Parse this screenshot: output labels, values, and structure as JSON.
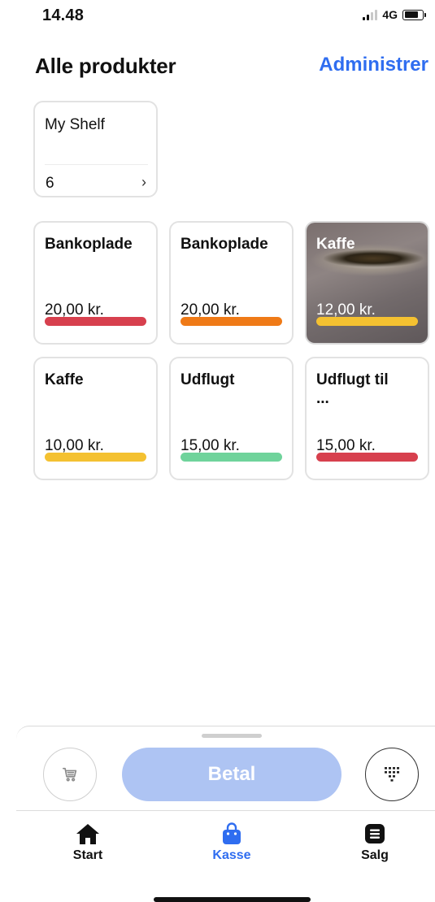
{
  "status_bar": {
    "time": "14.48",
    "network": "4G"
  },
  "header": {
    "title": "Alle produkter",
    "action": "Administrer"
  },
  "shelf": {
    "name": "My Shelf",
    "count": "6",
    "chevron": "›"
  },
  "products": [
    {
      "name": "Bankoplade",
      "price": "20,00 kr.",
      "color": "#d7404e"
    },
    {
      "name": "Bankoplade",
      "price": "20,00 kr.",
      "color": "#ef7a17"
    },
    {
      "name": "Kaffe",
      "price": "12,00 kr.",
      "color": "#f4c131",
      "has_image": true
    },
    {
      "name": "Kaffe",
      "price": "10,00 kr.",
      "color": "#f4c131"
    },
    {
      "name": "Udflugt",
      "price": "15,00 kr.",
      "color": "#6fd39b"
    },
    {
      "name": "Udflugt til ...",
      "price": "15,00 kr.",
      "color": "#d7404e"
    }
  ],
  "checkout": {
    "pay_label": "Betal",
    "cart_icon": "cart-icon",
    "keypad_icon": "keypad-icon"
  },
  "tabs": [
    {
      "label": "Start",
      "icon": "home-icon",
      "active": false
    },
    {
      "label": "Kasse",
      "icon": "shopping-bag-icon",
      "active": true
    },
    {
      "label": "Salg",
      "icon": "list-icon",
      "active": false
    }
  ],
  "colors": {
    "accent": "#2f6df0",
    "pay_button": "#aec4f3"
  }
}
